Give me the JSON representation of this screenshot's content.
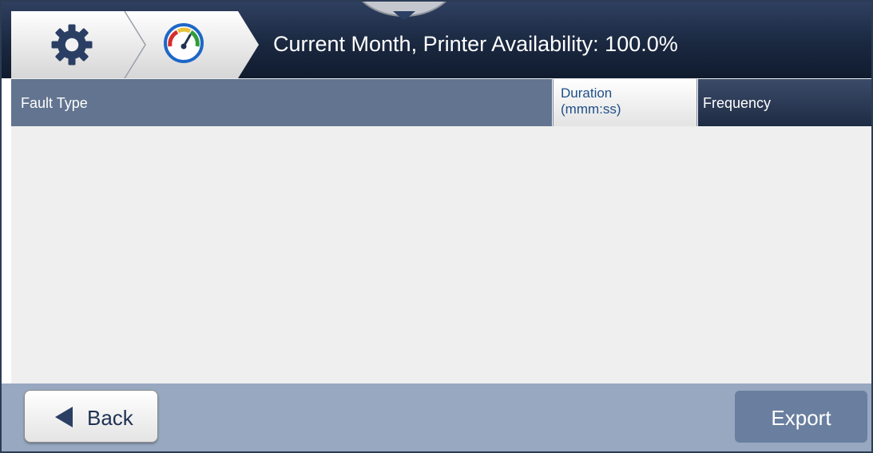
{
  "header": {
    "title": "Current Month, Printer Availability: 100.0%",
    "breadcrumb": [
      {
        "icon": "gear-icon"
      },
      {
        "icon": "gauge-icon"
      }
    ]
  },
  "table": {
    "columns": {
      "fault_type": "Fault Type",
      "duration_line1": "Duration",
      "duration_line2": "(mmm:ss)",
      "frequency": "Frequency"
    },
    "rows": []
  },
  "footer": {
    "back_label": "Back",
    "export_label": "Export"
  },
  "colors": {
    "header_dark": "#1a2840",
    "column_header": "#62748f",
    "footer_bg": "#97a8c0",
    "export_button": "#6a7f9f",
    "gauge_red": "#d62e2e",
    "gauge_green": "#2f9d3c",
    "gauge_blue": "#1e67c7"
  }
}
